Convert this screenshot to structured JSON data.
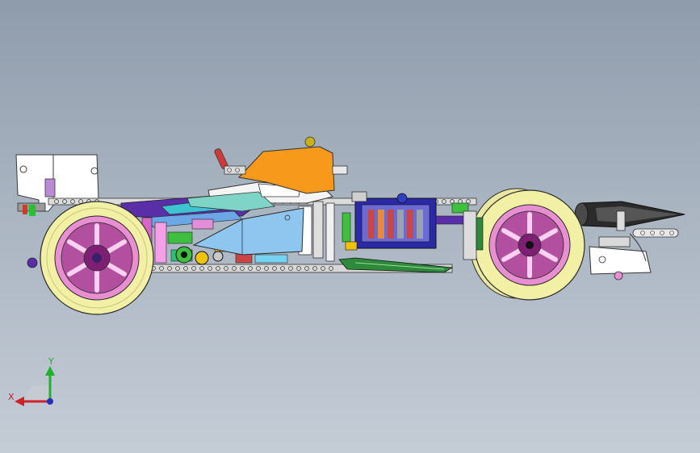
{
  "view": {
    "background_top": "#8f9cab",
    "background_bottom": "#c4ccd6"
  },
  "triad": {
    "x_label": "X",
    "y_label": "Y",
    "x_color": "#d0202a",
    "y_color": "#1fb02c",
    "z_color": "#2030c0"
  },
  "model": {
    "subject": "lego-technic-formula-car",
    "colors": {
      "tire": "#f2f0a4",
      "rim": "#e78fd1",
      "rim_dark": "#7d1f73",
      "orange_cover": "#f79a1c",
      "blue_panel": "#8fc6ef",
      "green_bar": "#2e8a3b",
      "frame_dark": "#2b2b2b",
      "purple_frame": "#5a2ea8"
    }
  }
}
